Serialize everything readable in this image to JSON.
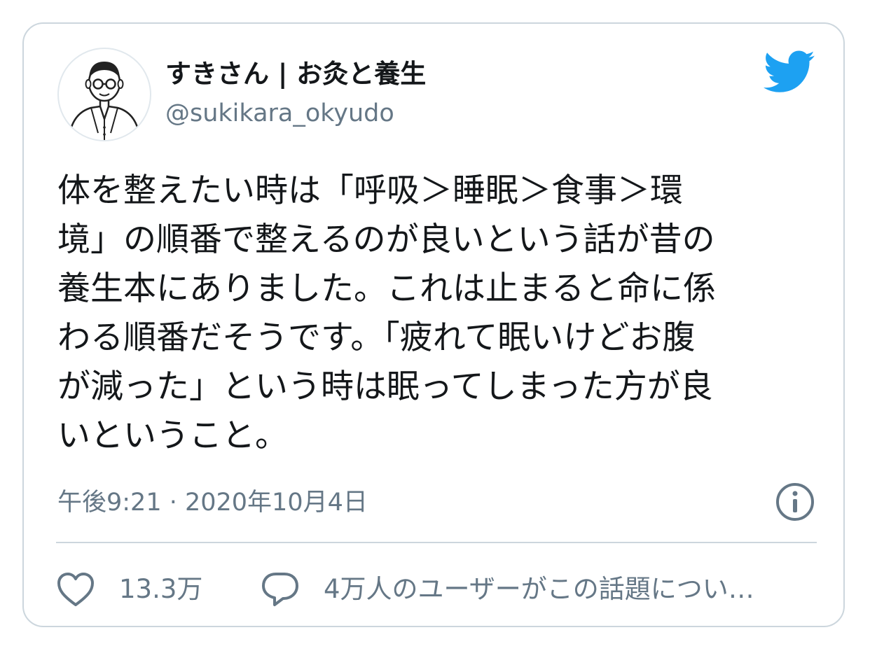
{
  "author": {
    "display_name": "すきさん | お灸と養生",
    "handle": "@sukikara_okyudo"
  },
  "icons": {
    "avatar": "person-illustration-avatar",
    "brand": "twitter-bird-icon",
    "info": "info-icon",
    "like": "heart-icon",
    "reply": "speech-bubble-icon"
  },
  "tweet": {
    "text": "体を整えたい時は「呼吸＞睡眠＞食事＞環\n境」の順番で整えるのが良いという話が昔の\n養生本にありました。これは止まると命に係\nわる順番だそうです。「疲れて眠いけどお腹\nが減った」という時は眠ってしまった方が良\nいということ。",
    "timestamp": "午後9:21 · 2020年10月4日"
  },
  "actions": {
    "like_count": "13.3万",
    "reply_text": "4万人のユーザーがこの話題につい…"
  },
  "colors": {
    "brand_blue": "#1da1f2",
    "secondary_text": "#657786",
    "primary_text": "#14171a",
    "border": "#ccd6dd"
  }
}
